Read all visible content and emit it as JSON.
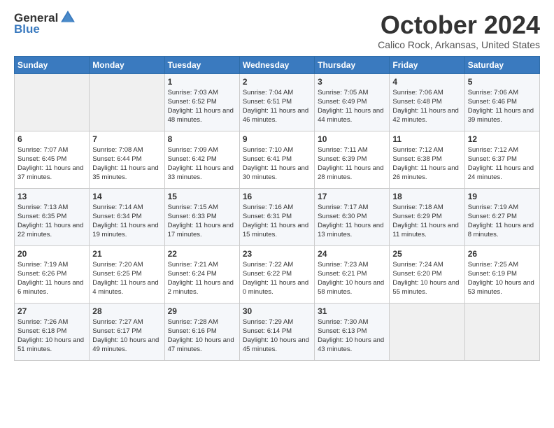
{
  "logo": {
    "general": "General",
    "blue": "Blue"
  },
  "title": "October 2024",
  "location": "Calico Rock, Arkansas, United States",
  "days_of_week": [
    "Sunday",
    "Monday",
    "Tuesday",
    "Wednesday",
    "Thursday",
    "Friday",
    "Saturday"
  ],
  "weeks": [
    [
      {
        "num": "",
        "info": ""
      },
      {
        "num": "",
        "info": ""
      },
      {
        "num": "1",
        "info": "Sunrise: 7:03 AM\nSunset: 6:52 PM\nDaylight: 11 hours and 48 minutes."
      },
      {
        "num": "2",
        "info": "Sunrise: 7:04 AM\nSunset: 6:51 PM\nDaylight: 11 hours and 46 minutes."
      },
      {
        "num": "3",
        "info": "Sunrise: 7:05 AM\nSunset: 6:49 PM\nDaylight: 11 hours and 44 minutes."
      },
      {
        "num": "4",
        "info": "Sunrise: 7:06 AM\nSunset: 6:48 PM\nDaylight: 11 hours and 42 minutes."
      },
      {
        "num": "5",
        "info": "Sunrise: 7:06 AM\nSunset: 6:46 PM\nDaylight: 11 hours and 39 minutes."
      }
    ],
    [
      {
        "num": "6",
        "info": "Sunrise: 7:07 AM\nSunset: 6:45 PM\nDaylight: 11 hours and 37 minutes."
      },
      {
        "num": "7",
        "info": "Sunrise: 7:08 AM\nSunset: 6:44 PM\nDaylight: 11 hours and 35 minutes."
      },
      {
        "num": "8",
        "info": "Sunrise: 7:09 AM\nSunset: 6:42 PM\nDaylight: 11 hours and 33 minutes."
      },
      {
        "num": "9",
        "info": "Sunrise: 7:10 AM\nSunset: 6:41 PM\nDaylight: 11 hours and 30 minutes."
      },
      {
        "num": "10",
        "info": "Sunrise: 7:11 AM\nSunset: 6:39 PM\nDaylight: 11 hours and 28 minutes."
      },
      {
        "num": "11",
        "info": "Sunrise: 7:12 AM\nSunset: 6:38 PM\nDaylight: 11 hours and 26 minutes."
      },
      {
        "num": "12",
        "info": "Sunrise: 7:12 AM\nSunset: 6:37 PM\nDaylight: 11 hours and 24 minutes."
      }
    ],
    [
      {
        "num": "13",
        "info": "Sunrise: 7:13 AM\nSunset: 6:35 PM\nDaylight: 11 hours and 22 minutes."
      },
      {
        "num": "14",
        "info": "Sunrise: 7:14 AM\nSunset: 6:34 PM\nDaylight: 11 hours and 19 minutes."
      },
      {
        "num": "15",
        "info": "Sunrise: 7:15 AM\nSunset: 6:33 PM\nDaylight: 11 hours and 17 minutes."
      },
      {
        "num": "16",
        "info": "Sunrise: 7:16 AM\nSunset: 6:31 PM\nDaylight: 11 hours and 15 minutes."
      },
      {
        "num": "17",
        "info": "Sunrise: 7:17 AM\nSunset: 6:30 PM\nDaylight: 11 hours and 13 minutes."
      },
      {
        "num": "18",
        "info": "Sunrise: 7:18 AM\nSunset: 6:29 PM\nDaylight: 11 hours and 11 minutes."
      },
      {
        "num": "19",
        "info": "Sunrise: 7:19 AM\nSunset: 6:27 PM\nDaylight: 11 hours and 8 minutes."
      }
    ],
    [
      {
        "num": "20",
        "info": "Sunrise: 7:19 AM\nSunset: 6:26 PM\nDaylight: 11 hours and 6 minutes."
      },
      {
        "num": "21",
        "info": "Sunrise: 7:20 AM\nSunset: 6:25 PM\nDaylight: 11 hours and 4 minutes."
      },
      {
        "num": "22",
        "info": "Sunrise: 7:21 AM\nSunset: 6:24 PM\nDaylight: 11 hours and 2 minutes."
      },
      {
        "num": "23",
        "info": "Sunrise: 7:22 AM\nSunset: 6:22 PM\nDaylight: 11 hours and 0 minutes."
      },
      {
        "num": "24",
        "info": "Sunrise: 7:23 AM\nSunset: 6:21 PM\nDaylight: 10 hours and 58 minutes."
      },
      {
        "num": "25",
        "info": "Sunrise: 7:24 AM\nSunset: 6:20 PM\nDaylight: 10 hours and 55 minutes."
      },
      {
        "num": "26",
        "info": "Sunrise: 7:25 AM\nSunset: 6:19 PM\nDaylight: 10 hours and 53 minutes."
      }
    ],
    [
      {
        "num": "27",
        "info": "Sunrise: 7:26 AM\nSunset: 6:18 PM\nDaylight: 10 hours and 51 minutes."
      },
      {
        "num": "28",
        "info": "Sunrise: 7:27 AM\nSunset: 6:17 PM\nDaylight: 10 hours and 49 minutes."
      },
      {
        "num": "29",
        "info": "Sunrise: 7:28 AM\nSunset: 6:16 PM\nDaylight: 10 hours and 47 minutes."
      },
      {
        "num": "30",
        "info": "Sunrise: 7:29 AM\nSunset: 6:14 PM\nDaylight: 10 hours and 45 minutes."
      },
      {
        "num": "31",
        "info": "Sunrise: 7:30 AM\nSunset: 6:13 PM\nDaylight: 10 hours and 43 minutes."
      },
      {
        "num": "",
        "info": ""
      },
      {
        "num": "",
        "info": ""
      }
    ]
  ]
}
